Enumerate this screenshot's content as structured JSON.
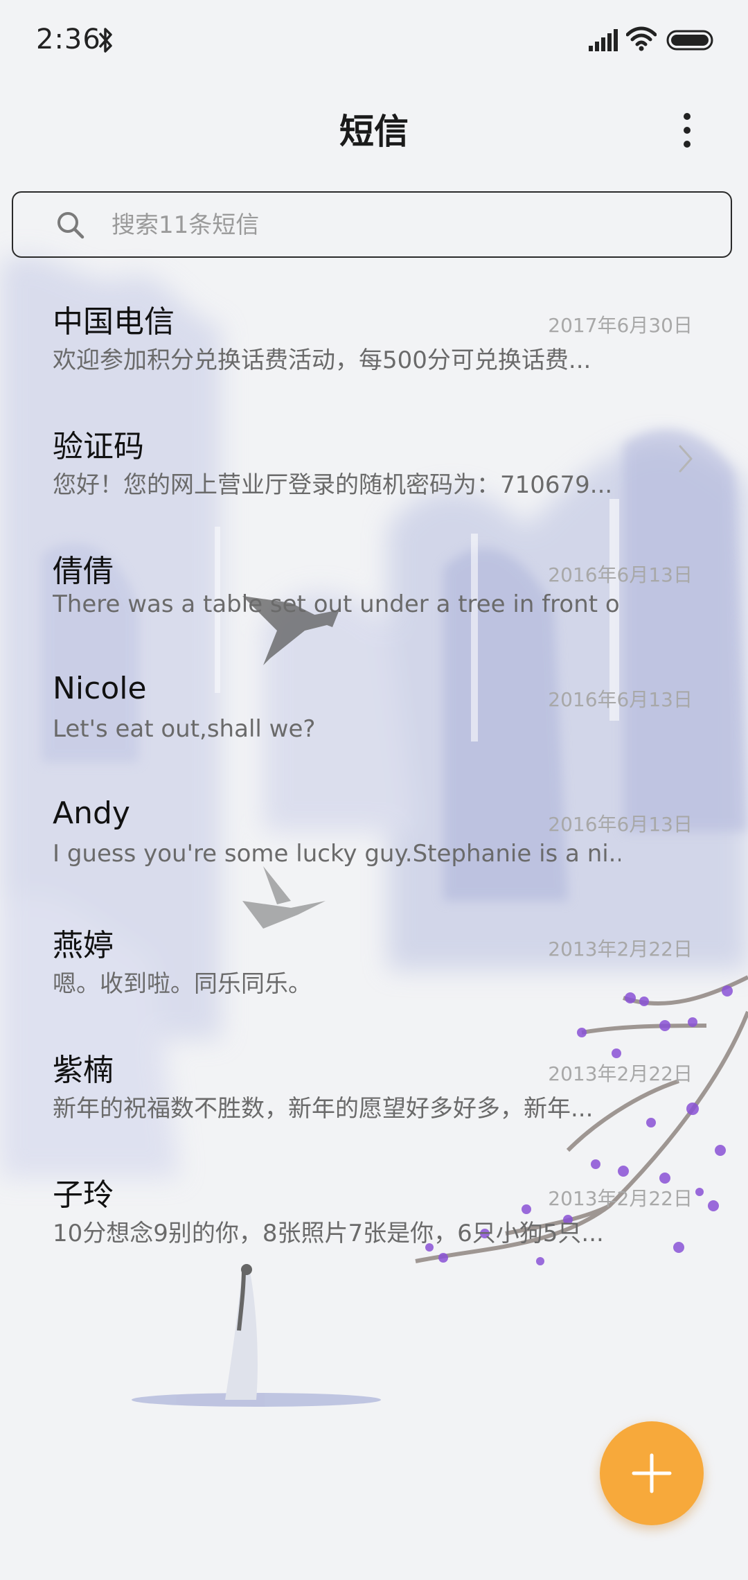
{
  "status_bar": {
    "time": "2:36"
  },
  "header": {
    "title": "短信"
  },
  "search": {
    "placeholder": "搜索11条短信"
  },
  "messages": [
    {
      "sender": "中国电信",
      "date": "2017年6月30日",
      "preview": "欢迎参加积分兑换话费活动，每500分可兑换话费..."
    },
    {
      "sender": "验证码",
      "date": "",
      "preview": "您好！您的网上营业厅登录的随机密码为：710679..."
    },
    {
      "sender": "倩倩",
      "date": "2016年6月13日",
      "preview": "There was a table set out under a tree in front o..."
    },
    {
      "sender": "Nicole",
      "date": "2016年6月13日",
      "preview": "Let's eat out,shall we?"
    },
    {
      "sender": "Andy",
      "date": "2016年6月13日",
      "preview": "I guess you're some lucky guy.Stephanie is a ni..."
    },
    {
      "sender": "燕婷",
      "date": "2013年2月22日",
      "preview": "嗯。收到啦。同乐同乐。"
    },
    {
      "sender": "紫楠",
      "date": "2013年2月22日",
      "preview": "新年的祝福数不胜数，新年的愿望好多好多，新年..."
    },
    {
      "sender": "子玲",
      "date": "2013年2月22日",
      "preview": "10分想念9别的你，8张照片7张是你，6只小狗5只..."
    }
  ],
  "icons": {
    "bluetooth": "bluetooth-icon",
    "signal": "signal-icon",
    "wifi": "wifi-icon",
    "battery": "battery-icon",
    "more": "more-vertical-icon",
    "search": "search-icon",
    "chevron": "chevron-right-icon",
    "compose": "plus-icon"
  },
  "colors": {
    "fab": "#f7a93b",
    "background": "#f2f3f5",
    "ink_wash": "#b8bfe0",
    "blossom": "#8a52d6"
  }
}
